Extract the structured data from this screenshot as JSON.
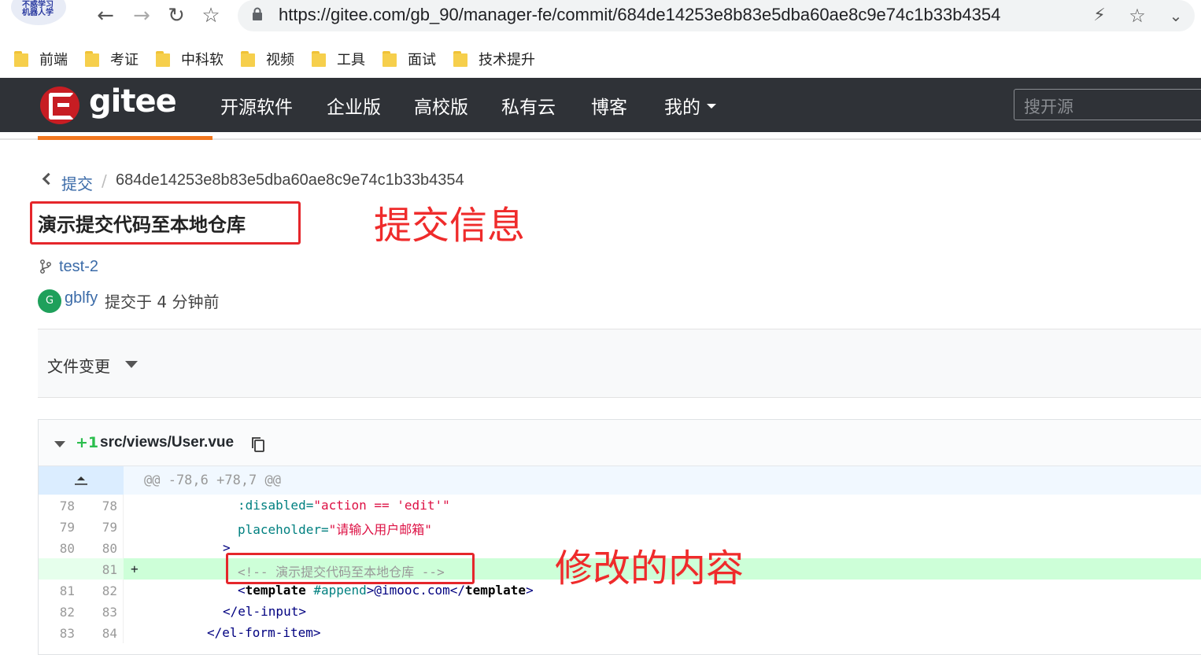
{
  "browser": {
    "url": "https://gitee.com/gb_90/manager-fe/commit/684de14253e8b83e5dba60ae8c9e74c1b33b4354",
    "profile_text": "不惑学习 机器人学"
  },
  "bookmarks": [
    "前端",
    "考证",
    "中科软",
    "视频",
    "工具",
    "面试",
    "技术提升"
  ],
  "header": {
    "logo": "gitee",
    "nav": [
      "开源软件",
      "企业版",
      "高校版",
      "私有云",
      "博客",
      "我的"
    ],
    "search_placeholder": "搜开源",
    "brand_color": "#c71d23",
    "accent": "#f2771e"
  },
  "breadcrumb": {
    "parent": "提交",
    "separator": "/",
    "hash": "684de14253e8b83e5dba60ae8c9e74c1b33b4354"
  },
  "commit": {
    "title": "演示提交代码至本地仓库",
    "branch": "test-2",
    "avatar_letter": "G",
    "author": "gblfy",
    "committed_text": "提交于 4 分钟前"
  },
  "annotations": {
    "commit_info": "提交信息",
    "changed_content": "修改的内容"
  },
  "file_changes": {
    "label": "文件变更"
  },
  "diff": {
    "additions": "+1",
    "path": "src/views/User.vue",
    "hunk": "@@ -78,6 +78,7 @@",
    "lines": [
      {
        "old": "78",
        "new": "78",
        "sign": ""
      },
      {
        "old": "79",
        "new": "79",
        "sign": ""
      },
      {
        "old": "80",
        "new": "80",
        "sign": ""
      },
      {
        "old": "",
        "new": "81",
        "sign": "+"
      },
      {
        "old": "81",
        "new": "82",
        "sign": ""
      },
      {
        "old": "82",
        "new": "83",
        "sign": ""
      },
      {
        "old": "83",
        "new": "84",
        "sign": ""
      }
    ],
    "code": {
      "l1_attr": ":disabled=",
      "l1_val": "\"action == 'edit'\"",
      "l2_attr": "placeholder=",
      "l2_val": "\"请输入用户邮箱\"",
      "l3": ">",
      "l4": "<!-- 演示提交代码至本地仓库 -->",
      "l5_open": "<",
      "l5_tag": "template",
      "l5_attr": " #append",
      "l5_mid": ">@imooc.com</",
      "l5_tag2": "template",
      "l5_close": ">",
      "l6": "</el-input>",
      "l7": "</el-form-item>"
    }
  }
}
